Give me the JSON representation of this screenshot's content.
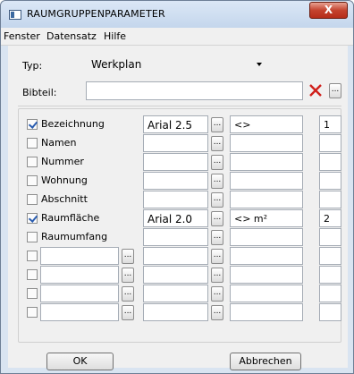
{
  "window": {
    "title": "RAUMGRUPPENPARAMETER",
    "close_glyph": "X"
  },
  "menu": [
    "Fenster",
    "Datensatz",
    "Hilfe"
  ],
  "form": {
    "typ_label": "Typ:",
    "typ_value": "Werkplan",
    "bibteil_label": "Bibteil:",
    "bibteil_value": ""
  },
  "rows": [
    {
      "checked": true,
      "label": "Bezeichnung",
      "font": "Arial 2.5",
      "format": "<>",
      "number": "1"
    },
    {
      "checked": false,
      "label": "Namen",
      "font": "",
      "format": "",
      "number": ""
    },
    {
      "checked": false,
      "label": "Nummer",
      "font": "",
      "format": "",
      "number": ""
    },
    {
      "checked": false,
      "label": "Wohnung",
      "font": "",
      "format": "",
      "number": ""
    },
    {
      "checked": false,
      "label": "Abschnitt",
      "font": "",
      "format": "",
      "number": ""
    },
    {
      "checked": true,
      "label": "Raumfläche",
      "font": "Arial 2.0",
      "format": "<> m²",
      "number": "2"
    },
    {
      "checked": false,
      "label": "Raumumfang",
      "font": "",
      "format": "",
      "number": ""
    }
  ],
  "custom_rows": [
    {
      "checked": false,
      "name": "",
      "font": "",
      "format": "",
      "number": ""
    },
    {
      "checked": false,
      "name": "",
      "font": "",
      "format": "",
      "number": ""
    },
    {
      "checked": false,
      "name": "",
      "font": "",
      "format": "",
      "number": ""
    },
    {
      "checked": false,
      "name": "",
      "font": "",
      "format": "",
      "number": ""
    }
  ],
  "buttons": {
    "ok": "OK",
    "cancel": "Abbrechen",
    "dots": "..."
  }
}
